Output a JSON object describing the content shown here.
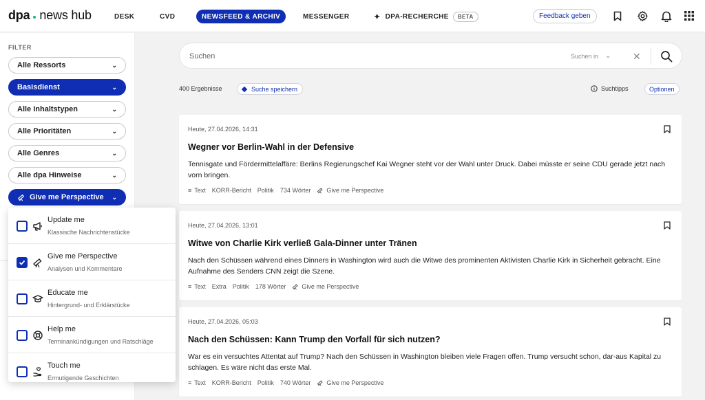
{
  "header": {
    "logo_left": "dpa",
    "logo_right": "news hub",
    "nav": [
      "DESK",
      "CVD",
      "NEWSFEED & ARCHIV",
      "MESSENGER",
      "DPA-RECHERCHE"
    ],
    "beta": "BETA",
    "feedback": "Feedback geben"
  },
  "sidebar": {
    "title": "FILTER",
    "filters": [
      "Alle Ressorts",
      "Basisdienst",
      "Alle Inhaltstypen",
      "Alle Prioritäten",
      "Alle Genres",
      "Alle dpa Hinweise",
      "Give me Perspective"
    ],
    "dropdown": [
      {
        "title": "Update me",
        "subtitle": "Klassische Nachrichtenstücke",
        "checked": false,
        "icon": "megaphone-icon"
      },
      {
        "title": "Give me Perspective",
        "subtitle": "Analysen und Kommentare",
        "checked": true,
        "icon": "telescope-icon"
      },
      {
        "title": "Educate me",
        "subtitle": "Hintergrund- und Erklärstücke",
        "checked": false,
        "icon": "graduation-cap-icon"
      },
      {
        "title": "Help me",
        "subtitle": "Terminankündigungen und Ratschläge",
        "checked": false,
        "icon": "lifebuoy-icon"
      },
      {
        "title": "Touch me",
        "subtitle": "Ermutigende Geschichten",
        "checked": false,
        "icon": "heart-hand-icon"
      }
    ]
  },
  "search": {
    "placeholder": "Suchen",
    "search_in": "Suchen in"
  },
  "results": {
    "count": "400 Ergebnisse",
    "save_search": "Suche speichern",
    "tips": "Suchtipps",
    "options": "Optionen"
  },
  "articles": [
    {
      "time": "Heute, 27.04.2026, 14:31",
      "title": "Wegner vor Berlin-Wahl in der Defensive",
      "body": "Tennisgate und Fördermittelaffäre: Berlins Regierungschef Kai Wegner steht vor der Wahl unter Druck. Dabei müsste er seine CDU gerade jetzt nach vorn bringen.",
      "meta": [
        "Text",
        "KORR-Bericht",
        "Politik",
        "734 Wörter",
        "Give me Perspective"
      ]
    },
    {
      "time": "Heute, 27.04.2026, 13:01",
      "title": "Witwe von Charlie Kirk verließ Gala-Dinner unter Tränen",
      "body": "Nach den Schüssen während eines Dinners in Washington wird auch die Witwe des prominenten Aktivisten Charlie Kirk in Sicherheit gebracht. Eine Aufnahme des Senders CNN zeigt die Szene.",
      "meta": [
        "Text",
        "Extra",
        "Politik",
        "178 Wörter",
        "Give me Perspective"
      ]
    },
    {
      "time": "Heute, 27.04.2026, 05:03",
      "title": "Nach den Schüssen: Kann Trump den Vorfall für sich nutzen?",
      "body": "War es ein versuchtes Attentat auf Trump? Nach den Schüssen in Washington bleiben viele Fragen offen. Trump versucht schon, dar-aus Kapital zu schlagen. Es wäre nicht das erste Mal.",
      "meta": [
        "Text",
        "KORR-Bericht",
        "Politik",
        "740 Wörter",
        "Give me Perspective"
      ]
    }
  ]
}
